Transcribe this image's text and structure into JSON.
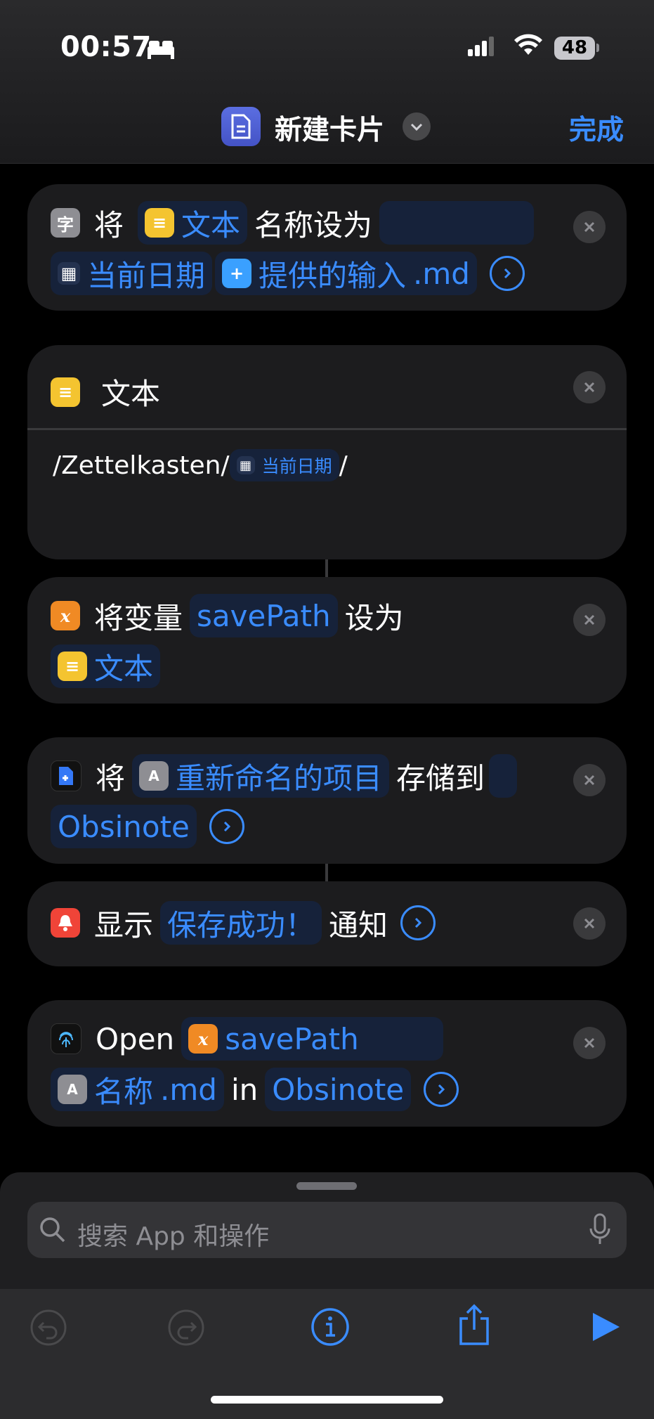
{
  "status_bar": {
    "time": "00:57",
    "battery": "48"
  },
  "header": {
    "title": "新建卡片",
    "done_label": "完成"
  },
  "card1": {
    "w_jiang": "将",
    "tok_text": "文本",
    "w_rename": "名称设为",
    "tok_date": "当前日期",
    "tok_input": "提供的输入",
    "tok_ext": ".md"
  },
  "card2": {
    "title": "文本",
    "path_prefix": "/Zettelkasten/",
    "tok_date": "当前日期",
    "path_suffix": "/"
  },
  "card3": {
    "w_setvar": "将变量",
    "tok_var": "savePath",
    "w_setto": "设为",
    "tok_text": "文本"
  },
  "card4": {
    "w_jiang": "将",
    "tok_item": "重新命名的项目",
    "w_saveto": "存储到",
    "tok_app": "Obsinote"
  },
  "card5": {
    "w_show": "显示",
    "tok_msg": "保存成功！",
    "w_notify": "通知"
  },
  "card6": {
    "w_open": "Open",
    "tok_var": "savePath",
    "tok_name": "名称",
    "tok_ext": ".md",
    "w_in": "in",
    "tok_app": "Obsinote"
  },
  "search": {
    "placeholder": "搜索 App 和操作"
  },
  "colors": {
    "accent": "#3a8cff",
    "background": "#000000",
    "card": "#1c1c1e"
  }
}
